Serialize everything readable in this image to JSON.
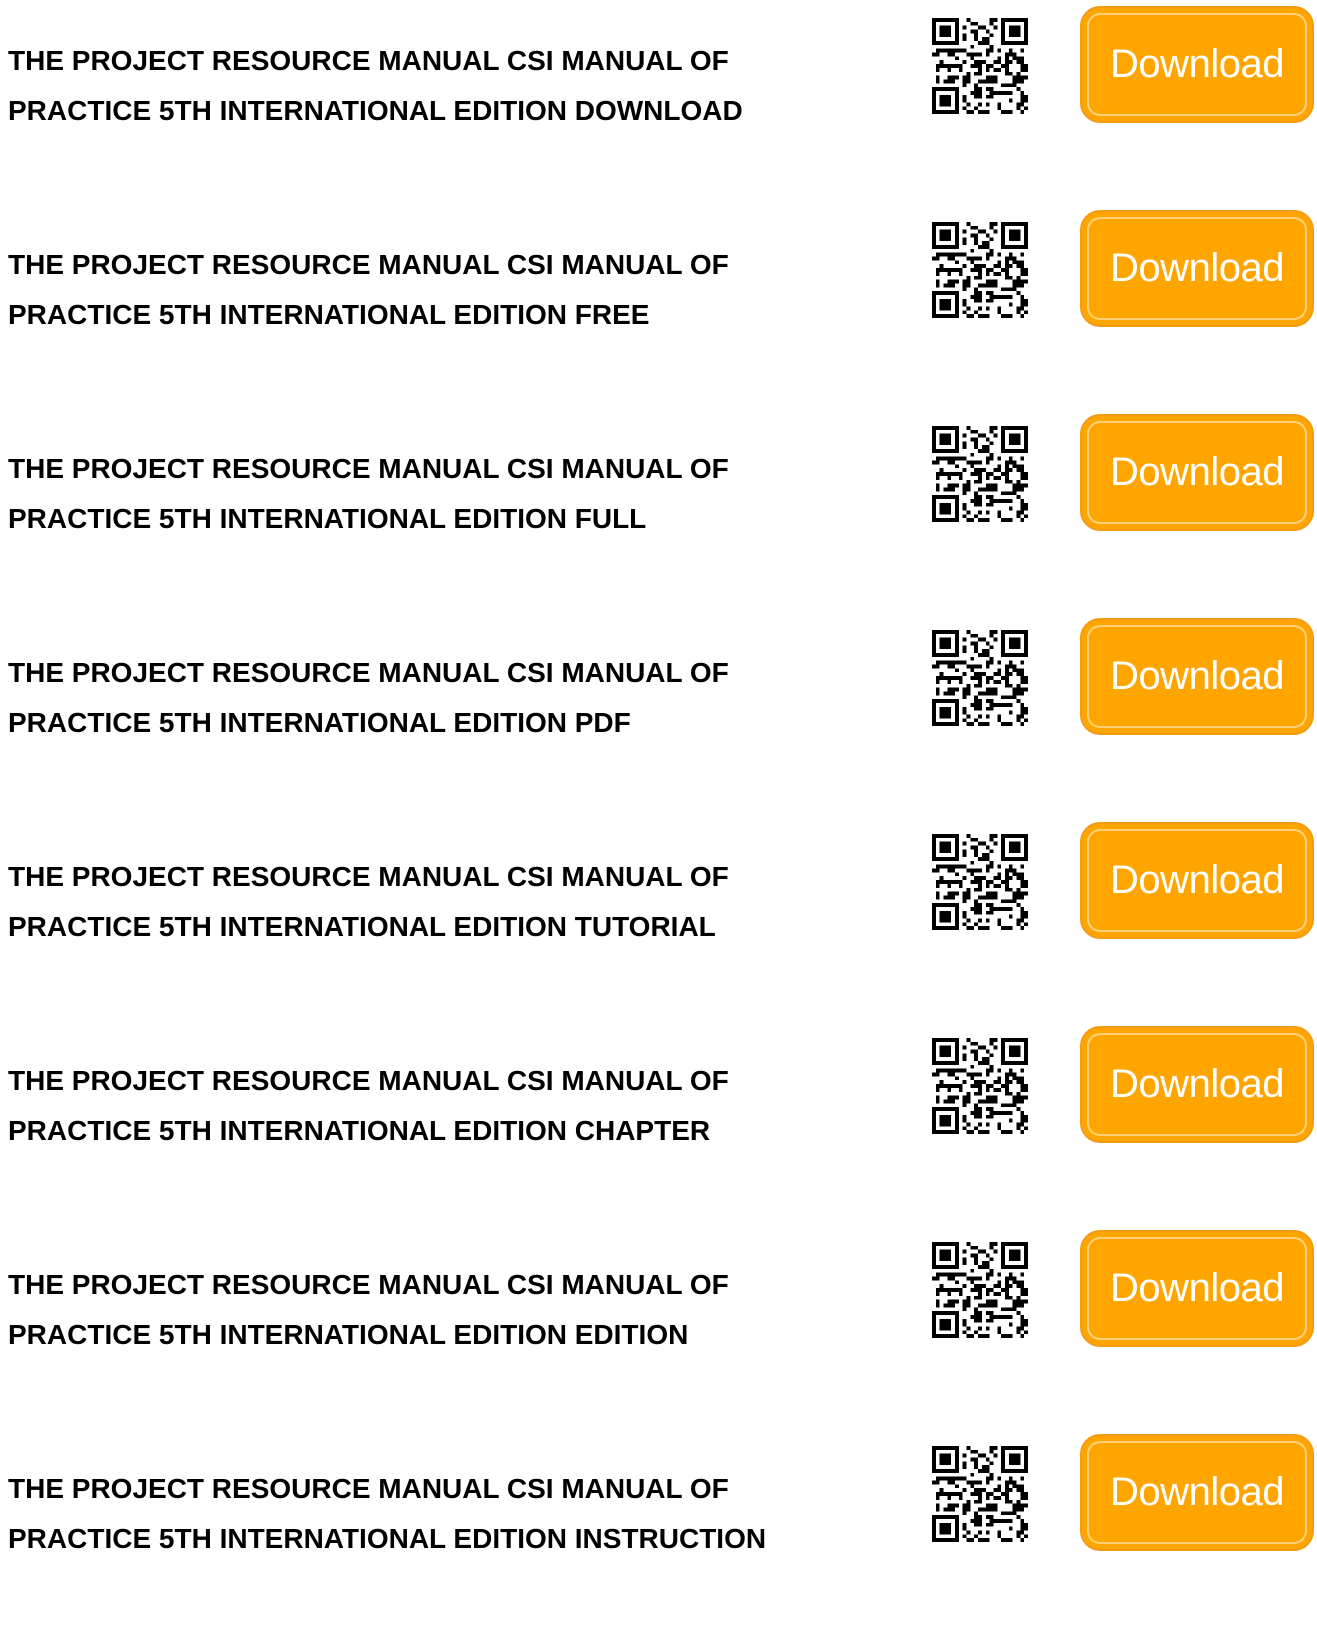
{
  "colors": {
    "button_fill": "#ffa500",
    "button_text": "#ffffff",
    "title_text": "#000000"
  },
  "items": [
    {
      "line1": "THE PROJECT RESOURCE MANUAL CSI MANUAL OF",
      "line2": "PRACTICE 5TH INTERNATIONAL EDITION DOWNLOAD",
      "qr_icon": "qr-code-icon",
      "button_label": "Download"
    },
    {
      "line1": "THE PROJECT RESOURCE MANUAL CSI MANUAL OF",
      "line2": "PRACTICE 5TH INTERNATIONAL EDITION FREE",
      "qr_icon": "qr-code-icon",
      "button_label": "Download"
    },
    {
      "line1": "THE PROJECT RESOURCE MANUAL CSI MANUAL OF",
      "line2": "PRACTICE 5TH INTERNATIONAL EDITION FULL",
      "qr_icon": "qr-code-icon",
      "button_label": "Download"
    },
    {
      "line1": "THE PROJECT RESOURCE MANUAL CSI MANUAL OF",
      "line2": "PRACTICE 5TH INTERNATIONAL EDITION PDF",
      "qr_icon": "qr-code-icon",
      "button_label": "Download"
    },
    {
      "line1": "THE PROJECT RESOURCE MANUAL CSI MANUAL OF",
      "line2": "PRACTICE 5TH INTERNATIONAL EDITION TUTORIAL",
      "qr_icon": "qr-code-icon",
      "button_label": "Download"
    },
    {
      "line1": "THE PROJECT RESOURCE MANUAL CSI MANUAL OF",
      "line2": "PRACTICE 5TH INTERNATIONAL EDITION CHAPTER",
      "qr_icon": "qr-code-icon",
      "button_label": "Download"
    },
    {
      "line1": "THE PROJECT RESOURCE MANUAL CSI MANUAL OF",
      "line2": "PRACTICE 5TH INTERNATIONAL EDITION EDITION",
      "qr_icon": "qr-code-icon",
      "button_label": "Download"
    },
    {
      "line1": "THE PROJECT RESOURCE MANUAL CSI MANUAL OF",
      "line2": "PRACTICE 5TH INTERNATIONAL EDITION INSTRUCTION",
      "qr_icon": "qr-code-icon",
      "button_label": "Download"
    }
  ]
}
